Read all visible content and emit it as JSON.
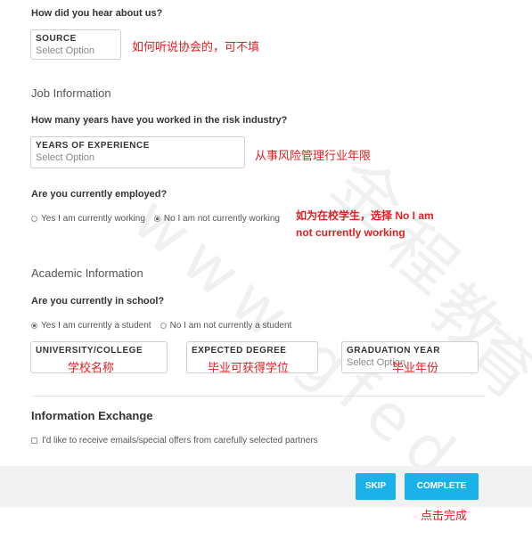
{
  "hear": {
    "question": "How did you hear about us?",
    "field_label": "SOURCE",
    "field_value": "Select Option",
    "note": "如何听说协会的，可不填"
  },
  "job": {
    "section_title": "Job Information",
    "years_question": "How many years have you worked in the risk industry?",
    "years_label": "YEARS OF EXPERIENCE",
    "years_value": "Select Option",
    "years_note": "从事风险管理行业年限",
    "employed_question": "Are you currently employed?",
    "employed_options": [
      {
        "label": "Yes I am currently working",
        "selected": false
      },
      {
        "label": "No I am not currently working",
        "selected": true
      }
    ],
    "employed_note_1": "如为在校学生，选择 No I am",
    "employed_note_2": "not currently working"
  },
  "academic": {
    "section_title": "Academic Information",
    "school_question": "Are you currently in school?",
    "school_options": [
      {
        "label": "Yes I am currently a student",
        "selected": true
      },
      {
        "label": "No I am not currently a student",
        "selected": false
      }
    ],
    "university_label": "UNIVERSITY/COLLEGE",
    "university_note": "学校名称",
    "degree_label": "EXPECTED DEGREE",
    "degree_note": "毕业可获得学位",
    "grad_label": "GRADUATION YEAR",
    "grad_value": "Select Option",
    "grad_note": "毕业年份"
  },
  "exchange": {
    "title": "Information Exchange",
    "checkbox_label": "I'd like to receive emails/special offers from carefully selected partners"
  },
  "footer": {
    "skip_label": "SKIP",
    "complete_label": "COMPLETE",
    "complete_note": "点击完成"
  },
  "watermark": {
    "chars": [
      "金",
      "程",
      "教",
      "育"
    ],
    "url": "www.gfedu"
  },
  "colors": {
    "accent": "#1ab2e8",
    "note": "#e02020"
  }
}
